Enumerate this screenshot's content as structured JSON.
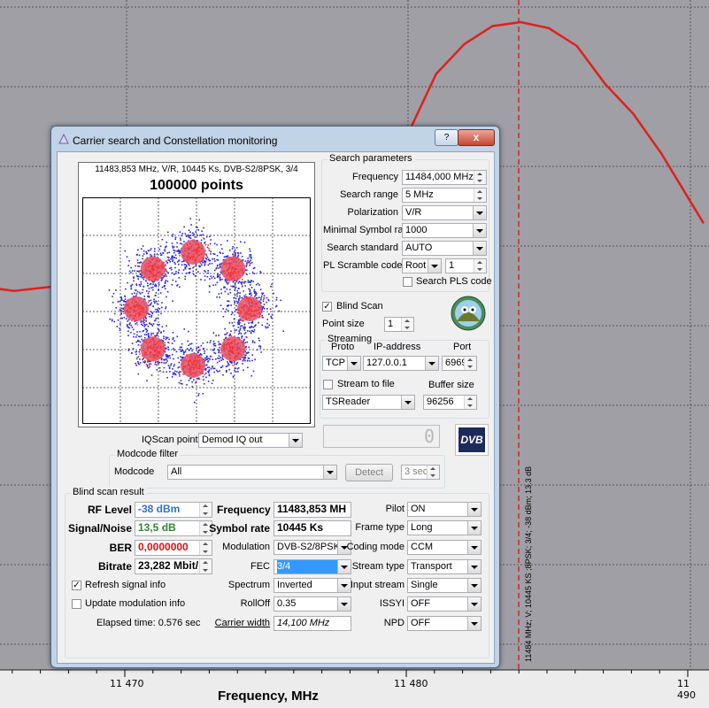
{
  "chart": {
    "x_ticks": [
      "11 470",
      "11 480",
      "11 490"
    ],
    "xlabel": "Frequency, MHz",
    "marker_label": "11484 MHz; V; 10445 KS ;8PSK; 3/4; -38 dBm; 13.3 dB",
    "line_color": "#e0201c",
    "chart_data": {
      "type": "line",
      "xlabel": "Frequency, MHz",
      "x": [
        11463,
        11464,
        11465,
        11466,
        11478,
        11479,
        11480,
        11481,
        11482,
        11483,
        11484,
        11485,
        11486,
        11487,
        11488,
        11489,
        11490.5
      ],
      "y": [
        -46,
        -45.8,
        -45.7,
        -45.9,
        -44,
        -42,
        -38,
        -35,
        -33.5,
        -32.6,
        -32.4,
        -32.7,
        -33.6,
        -35.5,
        -37,
        -39,
        -42.5
      ]
    }
  },
  "window": {
    "title": "Carrier search and Constellation monitoring",
    "help": "?",
    "close": "x"
  },
  "constellation": {
    "info": "11483,853 MHz, V/R, 10445 Ks, DVB-S2/8PSK, 3/4",
    "points": "100000 points"
  },
  "search": {
    "group": "Search parameters",
    "frequency_label": "Frequency",
    "frequency_value": "11484,000 MHz",
    "range_label": "Search range",
    "range_value": "5 MHz",
    "polarization_label": "Polarization",
    "polarization_value": "V/R",
    "min_sr_label": "Minimal Symbol rate",
    "min_sr_value": "1000",
    "standard_label": "Search standard",
    "standard_value": "AUTO",
    "pl_label": "PL Scramble code",
    "pl_root": "Root",
    "pl_value": "1",
    "search_pls": "Search PLS code"
  },
  "blind": {
    "label": "Blind Scan",
    "point_size_label": "Point size",
    "point_size_value": "1"
  },
  "streaming": {
    "group": "Streaming",
    "proto_label": "Proto",
    "ip_label": "IP-address",
    "port_label": "Port",
    "proto_value": "TCP",
    "ip_value": "127.0.0.1",
    "port_value": "6969",
    "stream_to_file": "Stream to file",
    "buffer_label": "Buffer size",
    "target_value": "TSReader",
    "buffer_value": "96256"
  },
  "iq": {
    "label": "IQScan point",
    "value": "Demod IQ out",
    "digit": "0",
    "logo": "DVB"
  },
  "modcode": {
    "group": "Modcode filter",
    "label": "Modcode",
    "value": "All",
    "detect": "Detect",
    "sec": "3 sec"
  },
  "result": {
    "group": "Blind scan result",
    "rf_label": "RF Level",
    "rf_value": "-38 dBm",
    "sn_label": "Signal/Noise",
    "sn_value": "13,5 dB",
    "ber_label": "BER",
    "ber_value": "0,0000000",
    "bitrate_label": "Bitrate",
    "bitrate_value": "23,282 Mbit/",
    "refresh": "Refresh signal info",
    "update": "Update modulation info",
    "elapsed": "Elapsed time: 0.576 sec",
    "freq_label": "Frequency",
    "freq_value": "11483,853 MH",
    "sr_label": "Symbol rate",
    "sr_value": "10445 Ks",
    "mod_label": "Modulation",
    "mod_value": "DVB-S2/8PSK",
    "fec_label": "FEC",
    "fec_value": "3/4",
    "spectrum_label": "Spectrum",
    "spectrum_value": "Inverted",
    "rolloff_label": "RollOff",
    "rolloff_value": "0.35",
    "cw_label": "Carrier width",
    "cw_value": "14,100 MHz",
    "pilot_label": "Pilot",
    "pilot_value": "ON",
    "frame_label": "Frame type",
    "frame_value": "Long",
    "coding_label": "Coding mode",
    "coding_value": "CCM",
    "stype_label": "Stream type",
    "stype_value": "Transport",
    "input_label": "Input stream",
    "input_value": "Single",
    "issyi_label": "ISSYI",
    "issyi_value": "OFF",
    "npd_label": "NPD",
    "npd_value": "OFF"
  }
}
